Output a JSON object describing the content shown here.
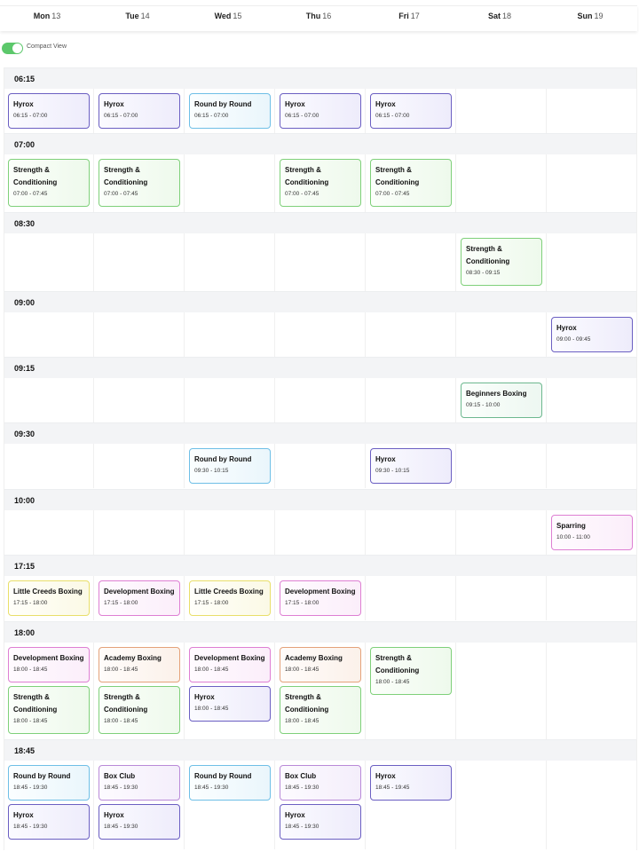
{
  "days": [
    {
      "name": "Mon",
      "num": "13"
    },
    {
      "name": "Tue",
      "num": "14"
    },
    {
      "name": "Wed",
      "num": "15"
    },
    {
      "name": "Thu",
      "num": "16"
    },
    {
      "name": "Fri",
      "num": "17"
    },
    {
      "name": "Sat",
      "num": "18"
    },
    {
      "name": "Sun",
      "num": "19"
    }
  ],
  "toggle": {
    "label": "Compact View",
    "on": true
  },
  "slots": [
    {
      "time": "06:15",
      "events": [
        {
          "day": 0,
          "title": "Hyrox",
          "time": "06:15 - 07:00",
          "color": "purple"
        },
        {
          "day": 1,
          "title": "Hyrox",
          "time": "06:15 - 07:00",
          "color": "purple"
        },
        {
          "day": 2,
          "title": "Round by Round",
          "time": "06:15 - 07:00",
          "color": "blue"
        },
        {
          "day": 3,
          "title": "Hyrox",
          "time": "06:15 - 07:00",
          "color": "purple"
        },
        {
          "day": 4,
          "title": "Hyrox",
          "time": "06:15 - 07:00",
          "color": "purple"
        }
      ]
    },
    {
      "time": "07:00",
      "events": [
        {
          "day": 0,
          "title": "Strength & Conditioning",
          "time": "07:00 - 07:45",
          "color": "green"
        },
        {
          "day": 1,
          "title": "Strength & Conditioning",
          "time": "07:00 - 07:45",
          "color": "green"
        },
        {
          "day": 3,
          "title": "Strength & Conditioning",
          "time": "07:00 - 07:45",
          "color": "green"
        },
        {
          "day": 4,
          "title": "Strength & Conditioning",
          "time": "07:00 - 07:45",
          "color": "green"
        }
      ]
    },
    {
      "time": "08:30",
      "events": [
        {
          "day": 5,
          "title": "Strength & Conditioning",
          "time": "08:30 - 09:15",
          "color": "green"
        }
      ]
    },
    {
      "time": "09:00",
      "events": [
        {
          "day": 6,
          "title": "Hyrox",
          "time": "09:00 - 09:45",
          "color": "purple"
        }
      ]
    },
    {
      "time": "09:15",
      "events": [
        {
          "day": 5,
          "title": "Beginners Boxing",
          "time": "09:15 - 10:00",
          "color": "teal"
        }
      ]
    },
    {
      "time": "09:30",
      "events": [
        {
          "day": 2,
          "title": "Round by Round",
          "time": "09:30 - 10:15",
          "color": "blue"
        },
        {
          "day": 4,
          "title": "Hyrox",
          "time": "09:30 - 10:15",
          "color": "purple"
        }
      ]
    },
    {
      "time": "10:00",
      "events": [
        {
          "day": 6,
          "title": "Sparring",
          "time": "10:00 - 11:00",
          "color": "pink"
        }
      ]
    },
    {
      "time": "17:15",
      "events": [
        {
          "day": 0,
          "title": "Little Creeds Boxing",
          "time": "17:15 - 18:00",
          "color": "yellow"
        },
        {
          "day": 1,
          "title": "Development Boxing",
          "time": "17:15 - 18:00",
          "color": "pink"
        },
        {
          "day": 2,
          "title": "Little Creeds Boxing",
          "time": "17:15 - 18:00",
          "color": "yellow"
        },
        {
          "day": 3,
          "title": "Development Boxing",
          "time": "17:15 - 18:00",
          "color": "pink"
        }
      ]
    },
    {
      "time": "18:00",
      "events": [
        {
          "day": 0,
          "title": "Development Boxing",
          "time": "18:00 - 18:45",
          "color": "pink"
        },
        {
          "day": 0,
          "title": "Strength & Conditioning",
          "time": "18:00 - 18:45",
          "color": "green"
        },
        {
          "day": 1,
          "title": "Academy Boxing",
          "time": "18:00 - 18:45",
          "color": "orange"
        },
        {
          "day": 1,
          "title": "Strength & Conditioning",
          "time": "18:00 - 18:45",
          "color": "green"
        },
        {
          "day": 2,
          "title": "Development Boxing",
          "time": "18:00 - 18:45",
          "color": "pink"
        },
        {
          "day": 2,
          "title": "Hyrox",
          "time": "18:00 - 18:45",
          "color": "purple"
        },
        {
          "day": 3,
          "title": "Academy Boxing",
          "time": "18:00 - 18:45",
          "color": "orange"
        },
        {
          "day": 3,
          "title": "Strength & Conditioning",
          "time": "18:00 - 18:45",
          "color": "green"
        },
        {
          "day": 4,
          "title": "Strength & Conditioning",
          "time": "18:00 - 18:45",
          "color": "green"
        }
      ]
    },
    {
      "time": "18:45",
      "events": [
        {
          "day": 0,
          "title": "Round by Round",
          "time": "18:45 - 19:30",
          "color": "blue"
        },
        {
          "day": 0,
          "title": "Hyrox",
          "time": "18:45 - 19:30",
          "color": "purple"
        },
        {
          "day": 1,
          "title": "Box Club",
          "time": "18:45 - 19:30",
          "color": "violet"
        },
        {
          "day": 1,
          "title": "Hyrox",
          "time": "18:45 - 19:30",
          "color": "purple"
        },
        {
          "day": 2,
          "title": "Round by Round",
          "time": "18:45 - 19:30",
          "color": "blue"
        },
        {
          "day": 3,
          "title": "Box Club",
          "time": "18:45 - 19:30",
          "color": "violet"
        },
        {
          "day": 3,
          "title": "Hyrox",
          "time": "18:45 - 19:30",
          "color": "purple"
        },
        {
          "day": 4,
          "title": "Hyrox",
          "time": "18:45 - 19:45",
          "color": "purple"
        }
      ]
    }
  ]
}
